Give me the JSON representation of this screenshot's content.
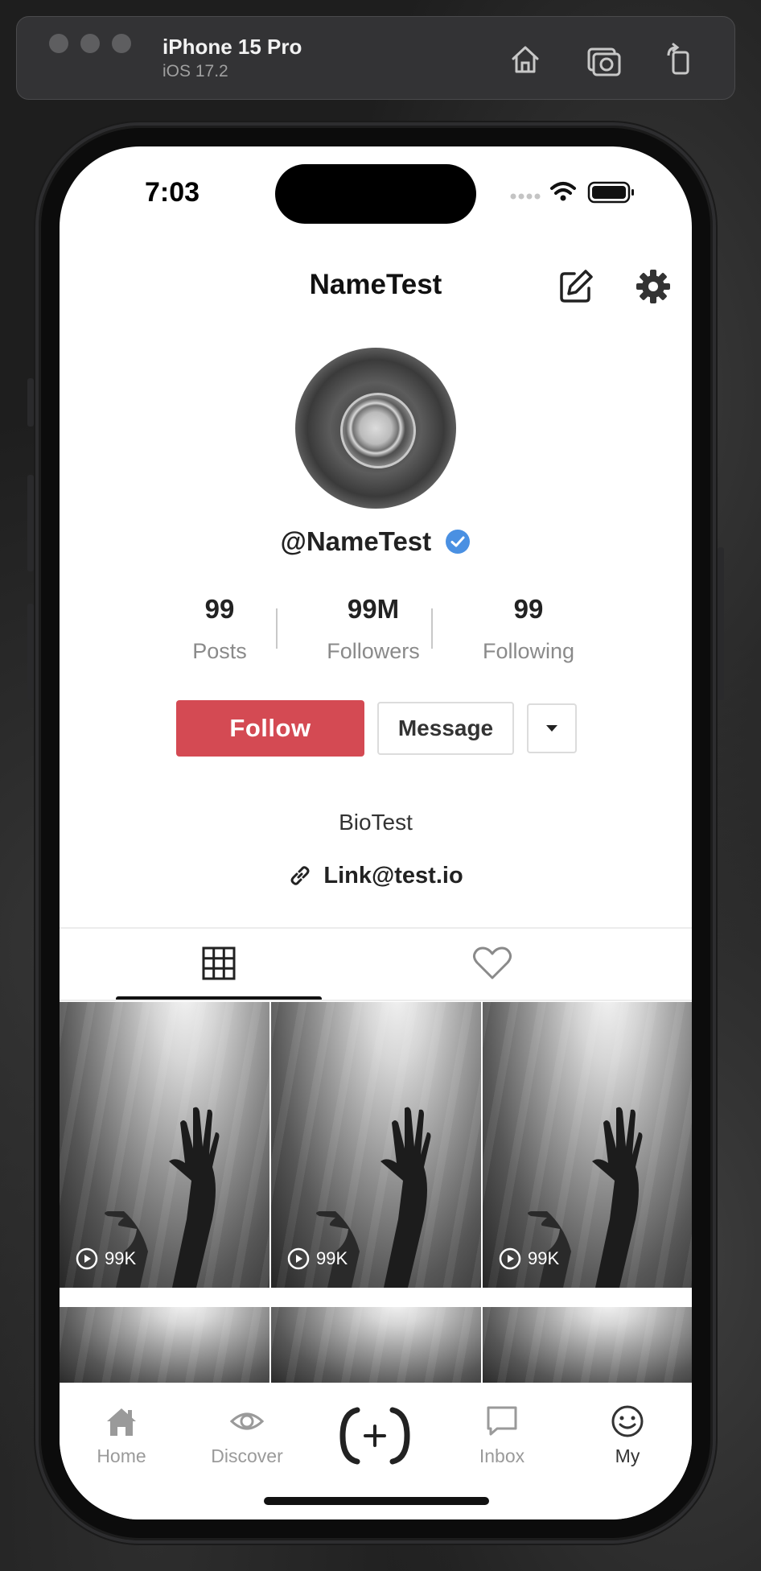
{
  "simulator": {
    "device_name": "iPhone 15 Pro",
    "os_version": "iOS 17.2"
  },
  "status_bar": {
    "time": "7:03"
  },
  "profile": {
    "title": "NameTest",
    "handle": "@NameTest",
    "verified": true,
    "bio": "BioTest",
    "link": "Link@test.io",
    "stats": [
      {
        "value": "99",
        "label": "Posts"
      },
      {
        "value": "99M",
        "label": "Followers"
      },
      {
        "value": "99",
        "label": "Following"
      }
    ],
    "actions": {
      "follow_label": "Follow",
      "message_label": "Message"
    }
  },
  "tabs": [
    {
      "name": "grid-icon",
      "active": true
    },
    {
      "name": "heart-icon",
      "active": false
    }
  ],
  "posts": [
    {
      "views": "99K"
    },
    {
      "views": "99K"
    },
    {
      "views": "99K"
    },
    {
      "views": ""
    },
    {
      "views": ""
    },
    {
      "views": ""
    }
  ],
  "bottom_nav": {
    "items": [
      {
        "label": "Home",
        "icon": "home-icon",
        "active": false
      },
      {
        "label": "Discover",
        "icon": "eye-icon",
        "active": false
      },
      {
        "label": "",
        "icon": "create-icon",
        "active": false
      },
      {
        "label": "Inbox",
        "icon": "message-icon",
        "active": false
      },
      {
        "label": "My",
        "icon": "smile-icon",
        "active": true
      }
    ]
  },
  "colors": {
    "accent": "#d44a53",
    "verified": "#4a90e2",
    "inactive": "#9a9a9a"
  }
}
